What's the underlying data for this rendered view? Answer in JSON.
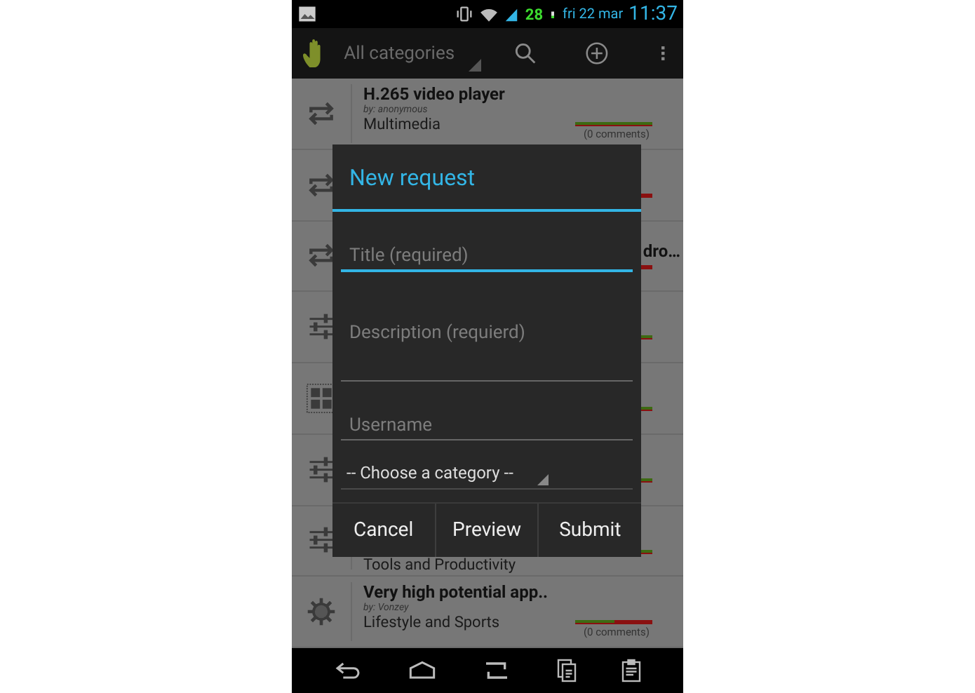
{
  "status_bar": {
    "battery_percent": "28",
    "date": "fri 22 mar",
    "time": "11:37"
  },
  "action_bar": {
    "category_spinner": "All categories"
  },
  "list": [
    {
      "kind": "repeat",
      "title": "H.265 video player",
      "author": "by: anonymous",
      "category": "Multimedia",
      "comments": "(0 comments)",
      "level": 1
    },
    {
      "kind": "repeat",
      "level": 0
    },
    {
      "kind": "repeat",
      "title": "dro…",
      "level": 0
    },
    {
      "kind": "sliders",
      "level": 1
    },
    {
      "kind": "grid",
      "level": 1
    },
    {
      "kind": "sliders",
      "level": 1
    },
    {
      "kind": "sliders",
      "category": "Tools and Productivity",
      "level": 1
    },
    {
      "kind": "gear",
      "title": "Very high potential app..",
      "author": "by: Vonzey",
      "category": "Lifestyle and Sports",
      "comments": "(0 comments)",
      "level": 0.5
    }
  ],
  "dialog": {
    "title": "New request",
    "fields": [
      {
        "placeholder": "Title (required)",
        "focused": true,
        "multiline": false
      },
      {
        "placeholder": "Description (requierd)",
        "focused": false,
        "multiline": true
      },
      {
        "placeholder": "Username",
        "focused": false,
        "multiline": false
      }
    ],
    "category_spinner": "-- Choose a category --",
    "buttons": [
      "Cancel",
      "Preview",
      "Submit"
    ]
  }
}
